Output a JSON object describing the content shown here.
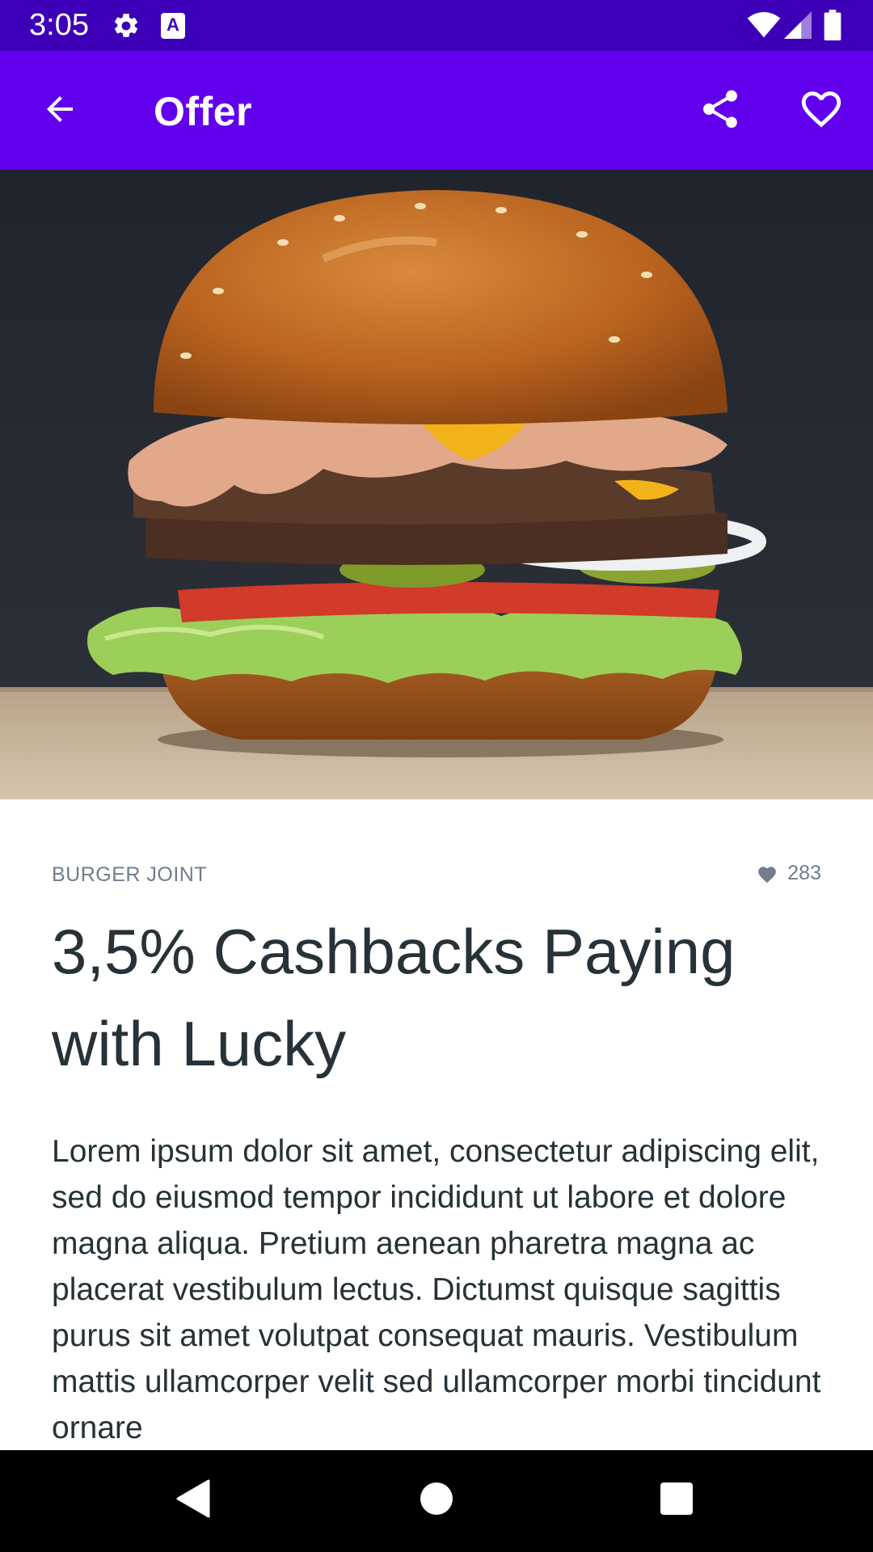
{
  "status_bar": {
    "time": "3:05",
    "a11y_glyph": "A",
    "icons": [
      "gear-icon",
      "accessibility-icon",
      "wifi-icon",
      "signal-icon",
      "battery-icon"
    ]
  },
  "app_bar": {
    "title": "Offer",
    "back_icon": "arrow-back-icon",
    "share_icon": "share-icon",
    "favorite_icon": "heart-outline-icon",
    "color": "#6200ee"
  },
  "hero": {
    "subject": "burger-photo"
  },
  "offer": {
    "merchant": "BURGER JOINT",
    "likes": "283",
    "title": "3,5% Cashbacks Paying with Lucky",
    "description": "Lorem ipsum dolor sit amet, consectetur adipiscing elit, sed do eiusmod tempor incididunt ut labore et dolore magna aliqua. Pretium aenean pharetra magna ac placerat vestibulum lectus. Dictumst quisque sagittis purus sit amet volutpat consequat mauris. Vestibulum mattis ullamcorper velit sed ullamcorper morbi tincidunt ornare"
  },
  "nav_bar": {
    "icons": [
      "nav-back-icon",
      "nav-home-icon",
      "nav-recents-icon"
    ]
  },
  "colors": {
    "status_bar": "#3d00b8",
    "app_bar": "#6200ee",
    "text_primary": "#263238",
    "text_secondary": "#6f7d8c"
  }
}
